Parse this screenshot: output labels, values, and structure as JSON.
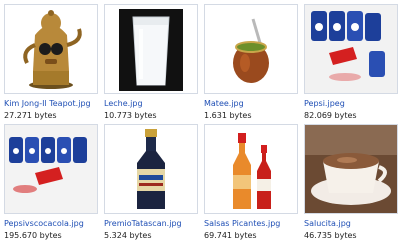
{
  "files": [
    {
      "name": "Kim Jong-Il Teapot.jpg",
      "size": "27.271 bytes",
      "icon": "teapot-photo-icon"
    },
    {
      "name": "Leche.jpg",
      "size": "10.773 bytes",
      "icon": "milk-glass-photo-icon"
    },
    {
      "name": "Matee.jpg",
      "size": "1.631 bytes",
      "icon": "mate-gourd-photo-icon"
    },
    {
      "name": "Pepsi.jpeg",
      "size": "82.069 bytes",
      "icon": "soda-cans-photo-icon"
    },
    {
      "name": "Pepsivscocacola.jpg",
      "size": "195.670 bytes",
      "icon": "soda-cans-photo-icon"
    },
    {
      "name": "PremioTatascan.jpg",
      "size": "5.324 bytes",
      "icon": "bottle-photo-icon"
    },
    {
      "name": "Salsas Picantes.jpg",
      "size": "69.741 bytes",
      "icon": "hot-sauce-photo-icon"
    },
    {
      "name": "Salucita.jpg",
      "size": "46.735 bytes",
      "icon": "cocoa-cup-photo-icon"
    }
  ],
  "colors": {
    "link": "#1f4fb5",
    "border": "#d4dae4"
  }
}
